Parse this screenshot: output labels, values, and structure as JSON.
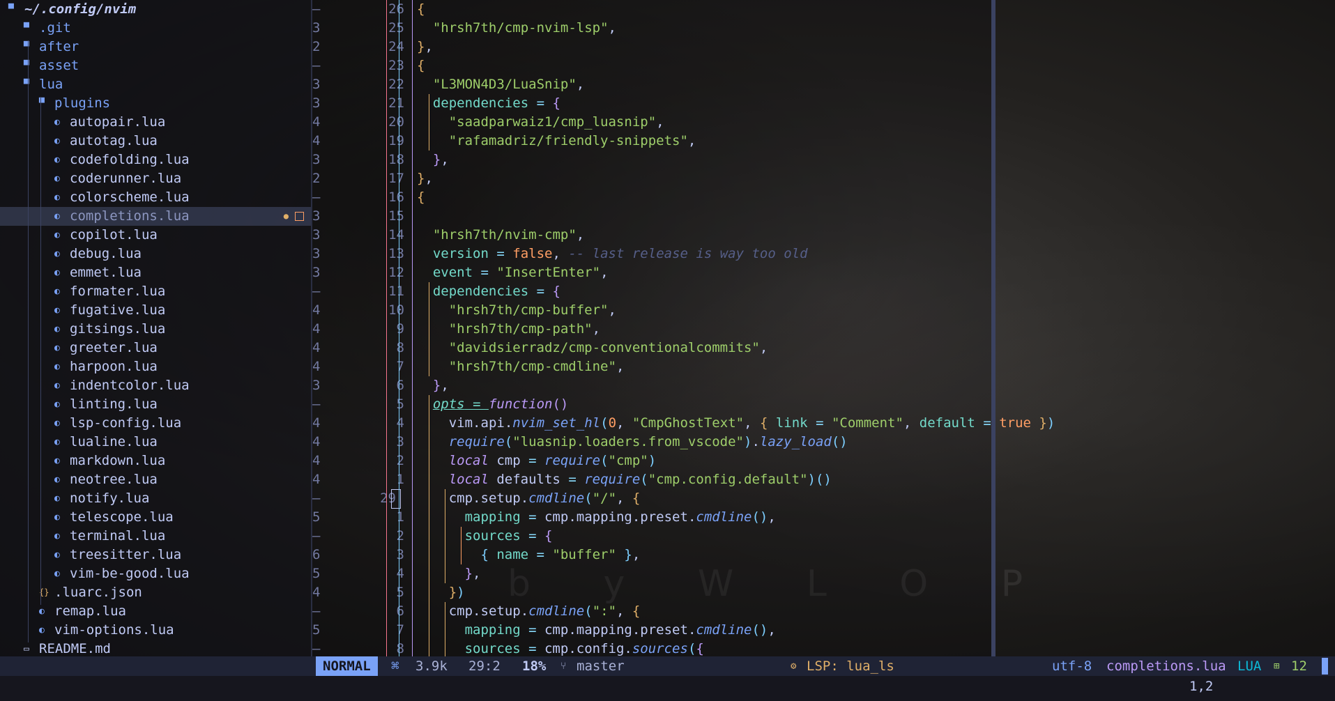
{
  "tree": {
    "root": "~/.config/nvim",
    "items": [
      {
        "label": ".git",
        "type": "dir",
        "depth": 1
      },
      {
        "label": "after",
        "type": "dir",
        "depth": 1
      },
      {
        "label": "asset",
        "type": "dir",
        "depth": 1
      },
      {
        "label": "lua",
        "type": "dir",
        "depth": 1
      },
      {
        "label": "plugins",
        "type": "dir",
        "depth": 2
      },
      {
        "label": "autopair.lua",
        "type": "file",
        "depth": 3
      },
      {
        "label": "autotag.lua",
        "type": "file",
        "depth": 3
      },
      {
        "label": "codefolding.lua",
        "type": "file",
        "depth": 3
      },
      {
        "label": "coderunner.lua",
        "type": "file",
        "depth": 3
      },
      {
        "label": "colorscheme.lua",
        "type": "file",
        "depth": 3
      },
      {
        "label": "completions.lua",
        "type": "file",
        "depth": 3,
        "selected": true,
        "modified": true
      },
      {
        "label": "copilot.lua",
        "type": "file",
        "depth": 3
      },
      {
        "label": "debug.lua",
        "type": "file",
        "depth": 3
      },
      {
        "label": "emmet.lua",
        "type": "file",
        "depth": 3
      },
      {
        "label": "formater.lua",
        "type": "file",
        "depth": 3
      },
      {
        "label": "fugative.lua",
        "type": "file",
        "depth": 3
      },
      {
        "label": "gitsings.lua",
        "type": "file",
        "depth": 3
      },
      {
        "label": "greeter.lua",
        "type": "file",
        "depth": 3
      },
      {
        "label": "harpoon.lua",
        "type": "file",
        "depth": 3
      },
      {
        "label": "indentcolor.lua",
        "type": "file",
        "depth": 3
      },
      {
        "label": "linting.lua",
        "type": "file",
        "depth": 3
      },
      {
        "label": "lsp-config.lua",
        "type": "file",
        "depth": 3
      },
      {
        "label": "lualine.lua",
        "type": "file",
        "depth": 3
      },
      {
        "label": "markdown.lua",
        "type": "file",
        "depth": 3
      },
      {
        "label": "neotree.lua",
        "type": "file",
        "depth": 3
      },
      {
        "label": "notify.lua",
        "type": "file",
        "depth": 3
      },
      {
        "label": "telescope.lua",
        "type": "file",
        "depth": 3
      },
      {
        "label": "terminal.lua",
        "type": "file",
        "depth": 3
      },
      {
        "label": "treesitter.lua",
        "type": "file",
        "depth": 3
      },
      {
        "label": "vim-be-good.lua",
        "type": "file",
        "depth": 3
      },
      {
        "label": ".luarc.json",
        "type": "json",
        "depth": 2
      },
      {
        "label": "remap.lua",
        "type": "file",
        "depth": 2
      },
      {
        "label": "vim-options.lua",
        "type": "file",
        "depth": 2
      },
      {
        "label": "README.md",
        "type": "md",
        "depth": 1
      }
    ]
  },
  "editor": {
    "lines": [
      {
        "sign": "–",
        "num": "26",
        "tokens": [
          [
            "br1",
            "{"
          ]
        ],
        "indent": 0
      },
      {
        "sign": "3",
        "num": "25",
        "tokens": [
          [
            "s",
            "\"hrsh7th/cmp-nvim-lsp\""
          ],
          [
            "p",
            ","
          ]
        ],
        "indent": 1
      },
      {
        "sign": "2",
        "num": "24",
        "tokens": [
          [
            "br1",
            "}"
          ],
          [
            "p",
            ","
          ]
        ],
        "indent": 0
      },
      {
        "sign": "–",
        "num": "23",
        "tokens": [
          [
            "br1",
            "{"
          ]
        ],
        "indent": 0
      },
      {
        "sign": "3",
        "num": "22",
        "tokens": [
          [
            "s",
            "\"L3MON4D3/LuaSnip\""
          ],
          [
            "p",
            ","
          ]
        ],
        "indent": 1
      },
      {
        "sign": "3",
        "num": "21",
        "tokens": [
          [
            "f",
            "dependencies"
          ],
          [
            "o",
            " = "
          ],
          [
            "br2",
            "{"
          ]
        ],
        "indent": 1
      },
      {
        "sign": "4",
        "num": "20",
        "tokens": [
          [
            "s",
            "\"saadparwaiz1/cmp_luasnip\""
          ],
          [
            "p",
            ","
          ]
        ],
        "indent": 2
      },
      {
        "sign": "4",
        "num": "19",
        "tokens": [
          [
            "s",
            "\"rafamadriz/friendly-snippets\""
          ],
          [
            "p",
            ","
          ]
        ],
        "indent": 2
      },
      {
        "sign": "3",
        "num": "18",
        "tokens": [
          [
            "br2",
            "}"
          ],
          [
            "p",
            ","
          ]
        ],
        "indent": 1
      },
      {
        "sign": "2",
        "num": "17",
        "tokens": [
          [
            "br1",
            "}"
          ],
          [
            "p",
            ","
          ]
        ],
        "indent": 0
      },
      {
        "sign": "–",
        "num": "16",
        "tokens": [
          [
            "br1",
            "{"
          ]
        ],
        "indent": 0
      },
      {
        "sign": "3",
        "num": "15",
        "tokens": [],
        "indent": 1
      },
      {
        "sign": "3",
        "num": "14",
        "tokens": [
          [
            "s",
            "\"hrsh7th/nvim-cmp\""
          ],
          [
            "p",
            ","
          ]
        ],
        "indent": 1
      },
      {
        "sign": "3",
        "num": "13",
        "tokens": [
          [
            "f",
            "version"
          ],
          [
            "o",
            " = "
          ],
          [
            "b",
            "false"
          ],
          [
            "p",
            ", "
          ],
          [
            "c",
            "-- last release is way too old"
          ]
        ],
        "indent": 1
      },
      {
        "sign": "3",
        "num": "12",
        "tokens": [
          [
            "f",
            "event"
          ],
          [
            "o",
            " = "
          ],
          [
            "s",
            "\"InsertEnter\""
          ],
          [
            "p",
            ","
          ]
        ],
        "indent": 1
      },
      {
        "sign": "–",
        "num": "11",
        "tokens": [
          [
            "f",
            "dependencies"
          ],
          [
            "o",
            " = "
          ],
          [
            "br2",
            "{"
          ]
        ],
        "indent": 1
      },
      {
        "sign": "4",
        "num": "10",
        "tokens": [
          [
            "s",
            "\"hrsh7th/cmp-buffer\""
          ],
          [
            "p",
            ","
          ]
        ],
        "indent": 2
      },
      {
        "sign": "4",
        "num": "9",
        "tokens": [
          [
            "s",
            "\"hrsh7th/cmp-path\""
          ],
          [
            "p",
            ","
          ]
        ],
        "indent": 2
      },
      {
        "sign": "4",
        "num": "8",
        "tokens": [
          [
            "s",
            "\"davidsierradz/cmp-conventionalcommits\""
          ],
          [
            "p",
            ","
          ]
        ],
        "indent": 2
      },
      {
        "sign": "4",
        "num": "7",
        "tokens": [
          [
            "s",
            "\"hrsh7th/cmp-cmdline\""
          ],
          [
            "p",
            ","
          ]
        ],
        "indent": 2
      },
      {
        "sign": "3",
        "num": "6",
        "tokens": [
          [
            "br2",
            "}"
          ],
          [
            "p",
            ","
          ]
        ],
        "indent": 1
      },
      {
        "sign": "–",
        "num": "5",
        "tokens": [
          [
            "opts",
            "opts"
          ],
          [
            "opts",
            " = "
          ],
          [
            "kw",
            "function"
          ],
          [
            "br2",
            "()"
          ]
        ],
        "indent": 1
      },
      {
        "sign": "4",
        "num": "4",
        "tokens": [
          [
            "id",
            "vim"
          ],
          [
            "p",
            "."
          ],
          [
            "id",
            "api"
          ],
          [
            "p",
            "."
          ],
          [
            "fn",
            "nvim_set_hl"
          ],
          [
            "br3",
            "("
          ],
          [
            "n",
            "0"
          ],
          [
            "p",
            ", "
          ],
          [
            "s",
            "\"CmpGhostText\""
          ],
          [
            "p",
            ", "
          ],
          [
            "br1",
            "{ "
          ],
          [
            "f",
            "link"
          ],
          [
            "o",
            " = "
          ],
          [
            "s",
            "\"Comment\""
          ],
          [
            "p",
            ", "
          ],
          [
            "f",
            "default"
          ],
          [
            "o",
            " = "
          ],
          [
            "b",
            "true"
          ],
          [
            "br1",
            " }"
          ],
          [
            "br3",
            ")"
          ]
        ],
        "indent": 2
      },
      {
        "sign": "4",
        "num": "3",
        "tokens": [
          [
            "fn",
            "require"
          ],
          [
            "br3",
            "("
          ],
          [
            "s",
            "\"luasnip.loaders.from_vscode\""
          ],
          [
            "br3",
            ")"
          ],
          [
            "p",
            "."
          ],
          [
            "fn",
            "lazy_load"
          ],
          [
            "br3",
            "()"
          ]
        ],
        "indent": 2
      },
      {
        "sign": "4",
        "num": "2",
        "tokens": [
          [
            "kw",
            "local"
          ],
          [
            "id",
            " cmp"
          ],
          [
            "o",
            " = "
          ],
          [
            "fn",
            "require"
          ],
          [
            "br3",
            "("
          ],
          [
            "s",
            "\"cmp\""
          ],
          [
            "br3",
            ")"
          ]
        ],
        "indent": 2
      },
      {
        "sign": "4",
        "num": "1",
        "tokens": [
          [
            "kw",
            "local"
          ],
          [
            "id",
            " defaults"
          ],
          [
            "o",
            " = "
          ],
          [
            "fn",
            "require"
          ],
          [
            "br3",
            "("
          ],
          [
            "s",
            "\"cmp.config.default\""
          ],
          [
            "br3",
            ")()"
          ]
        ],
        "indent": 2
      },
      {
        "sign": "–",
        "num": "29",
        "tokens": [
          [
            "id",
            "cmp"
          ],
          [
            "p",
            "."
          ],
          [
            "id",
            "setup"
          ],
          [
            "p",
            "."
          ],
          [
            "fn",
            "cmdline"
          ],
          [
            "br3",
            "("
          ],
          [
            "s",
            "\"/\""
          ],
          [
            "p",
            ", "
          ],
          [
            "br1",
            "{"
          ]
        ],
        "indent": 2,
        "current": true
      },
      {
        "sign": "5",
        "num": "1",
        "tokens": [
          [
            "f",
            "mapping"
          ],
          [
            "o",
            " = "
          ],
          [
            "id",
            "cmp"
          ],
          [
            "p",
            "."
          ],
          [
            "id",
            "mapping"
          ],
          [
            "p",
            "."
          ],
          [
            "id",
            "preset"
          ],
          [
            "p",
            "."
          ],
          [
            "fn",
            "cmdline"
          ],
          [
            "br3",
            "()"
          ],
          [
            "p",
            ","
          ]
        ],
        "indent": 3
      },
      {
        "sign": "–",
        "num": "2",
        "tokens": [
          [
            "f",
            "sources"
          ],
          [
            "o",
            " = "
          ],
          [
            "br2",
            "{"
          ]
        ],
        "indent": 3
      },
      {
        "sign": "6",
        "num": "3",
        "tokens": [
          [
            "br3",
            "{ "
          ],
          [
            "f",
            "name"
          ],
          [
            "o",
            " = "
          ],
          [
            "s",
            "\"buffer\""
          ],
          [
            "br3",
            " }"
          ],
          [
            "p",
            ","
          ]
        ],
        "indent": 4
      },
      {
        "sign": "5",
        "num": "4",
        "tokens": [
          [
            "br2",
            "}"
          ],
          [
            "p",
            ","
          ]
        ],
        "indent": 3
      },
      {
        "sign": "4",
        "num": "5",
        "tokens": [
          [
            "br1",
            "}"
          ],
          [
            "br3",
            ")"
          ]
        ],
        "indent": 2
      },
      {
        "sign": "–",
        "num": "6",
        "tokens": [
          [
            "id",
            "cmp"
          ],
          [
            "p",
            "."
          ],
          [
            "id",
            "setup"
          ],
          [
            "p",
            "."
          ],
          [
            "fn",
            "cmdline"
          ],
          [
            "br3",
            "("
          ],
          [
            "s",
            "\":\""
          ],
          [
            "p",
            ", "
          ],
          [
            "br1",
            "{"
          ]
        ],
        "indent": 2
      },
      {
        "sign": "5",
        "num": "7",
        "tokens": [
          [
            "f",
            "mapping"
          ],
          [
            "o",
            " = "
          ],
          [
            "id",
            "cmp"
          ],
          [
            "p",
            "."
          ],
          [
            "id",
            "mapping"
          ],
          [
            "p",
            "."
          ],
          [
            "id",
            "preset"
          ],
          [
            "p",
            "."
          ],
          [
            "fn",
            "cmdline"
          ],
          [
            "br3",
            "()"
          ],
          [
            "p",
            ","
          ]
        ],
        "indent": 3
      },
      {
        "sign": "–",
        "num": "8",
        "tokens": [
          [
            "f",
            "sources"
          ],
          [
            "o",
            " = "
          ],
          [
            "id",
            "cmp"
          ],
          [
            "p",
            "."
          ],
          [
            "id",
            "config"
          ],
          [
            "p",
            "."
          ],
          [
            "fn",
            "sources"
          ],
          [
            "br3",
            "("
          ],
          [
            "br2",
            "{"
          ]
        ],
        "indent": 3
      }
    ]
  },
  "status": {
    "mode": "NORMAL",
    "size_icon": "⌘",
    "size": "3.9k",
    "position": "29:2",
    "percent": "18%",
    "branch_icon": "branch-icon",
    "branch": "master",
    "lsp": "LSP: lua_ls",
    "encoding": "utf-8",
    "filename": "completions.lua",
    "filetype": "LUA",
    "diag_count": "12"
  },
  "cmdline": {
    "position": "1,2"
  },
  "watermark": "b y   W L O P",
  "colors": {
    "accent": "#7aa2f7",
    "string": "#9ece6a",
    "keyword": "#bb9af7",
    "field": "#73daca",
    "boolean": "#ff9e64",
    "comment": "#565f89",
    "statusline": "#1f2335"
  }
}
